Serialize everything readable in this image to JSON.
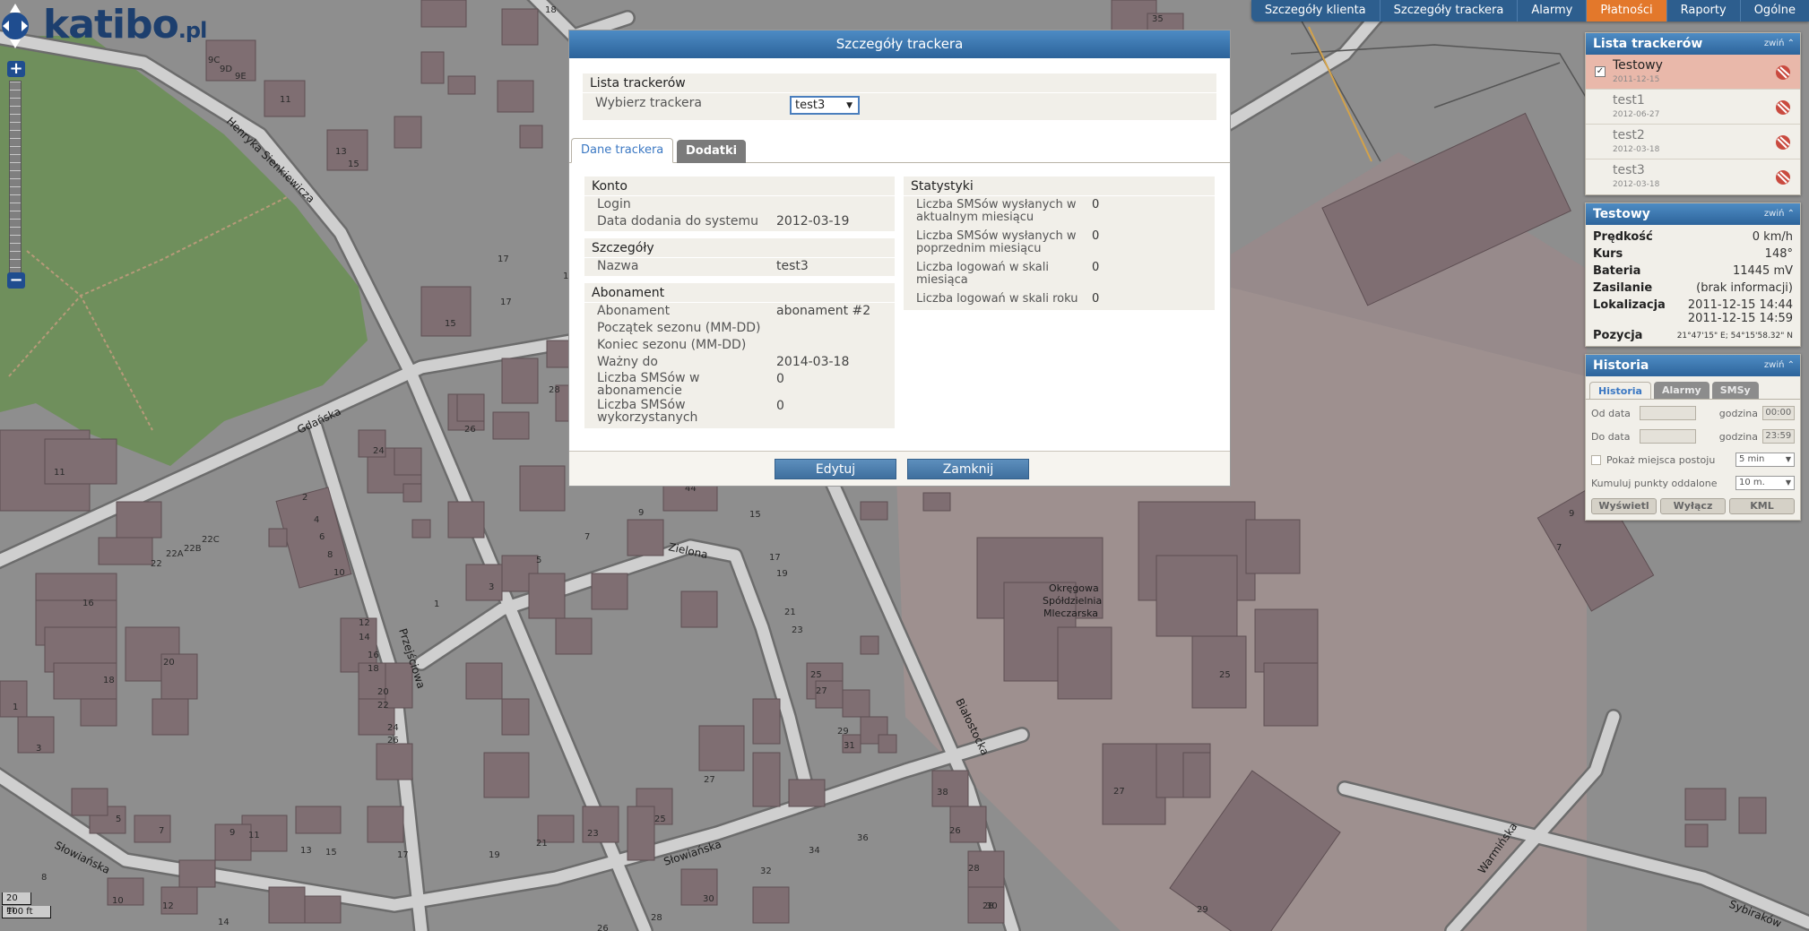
{
  "logo": {
    "text": "katibo",
    "tld": ".pl"
  },
  "topmenu": {
    "items": [
      "Szczegóły klienta",
      "Szczegóły trackera",
      "Alarmy",
      "Płatności",
      "Raporty",
      "Ogólne"
    ],
    "active_index": 3
  },
  "map": {
    "streets": [
      "Henryka Sienkiewicza",
      "Gdańska",
      "Przejściowa",
      "Zielona",
      "Białostocka",
      "Słowiańska",
      "Słowiańska",
      "Warmińska",
      "Sybiraków"
    ],
    "poi_label_lines": [
      "Okręgowa",
      "Spółdzielnia",
      "Mleczarska"
    ],
    "house_numbers": [
      "18",
      "35",
      "9C",
      "9D",
      "9E",
      "11",
      "13",
      "15",
      "17",
      "15",
      "28",
      "26",
      "24",
      "11",
      "26",
      "2",
      "4",
      "6",
      "8",
      "10",
      "22",
      "22A",
      "22B",
      "22C",
      "16",
      "20",
      "18",
      "1",
      "3",
      "1",
      "3",
      "5",
      "7",
      "9",
      "11",
      "13",
      "15",
      "12",
      "14",
      "16",
      "18",
      "20",
      "22",
      "24",
      "26",
      "17",
      "21",
      "23",
      "25",
      "27",
      "29",
      "31",
      "34",
      "36",
      "38",
      "26",
      "28",
      "30",
      "27",
      "25",
      "23",
      "21",
      "19",
      "17",
      "19",
      "21",
      "23",
      "25",
      "27",
      "29",
      "30",
      "32",
      "44",
      "15",
      "9",
      "7",
      "5",
      "3",
      "25",
      "27",
      "7",
      "9",
      "2",
      "12",
      "14",
      "16"
    ],
    "scale": {
      "metric": "20 m",
      "imperial": "100 ft"
    }
  },
  "tracker_list_panel": {
    "title": "Lista trackerów",
    "collapse_label": "zwiń",
    "items": [
      {
        "name": "Testowy",
        "date": "2011-12-15",
        "checked": true,
        "selected": true
      },
      {
        "name": "test1",
        "date": "2012-06-27",
        "checked": false,
        "selected": false
      },
      {
        "name": "test2",
        "date": "2012-03-18",
        "checked": false,
        "selected": false
      },
      {
        "name": "test3",
        "date": "2012-03-18",
        "checked": false,
        "selected": false
      }
    ]
  },
  "info_panel": {
    "title": "Testowy",
    "collapse_label": "zwiń",
    "rows": [
      {
        "label": "Prędkość",
        "value": "0 km/h"
      },
      {
        "label": "Kurs",
        "value": "148°"
      },
      {
        "label": "Bateria",
        "value": "11445 mV"
      },
      {
        "label": "Zasilanie",
        "value": "(brak informacji)"
      },
      {
        "label": "Lokalizacja",
        "value": "2011-12-15 14:44 2011-12-15 14:59"
      },
      {
        "label": "Pozycja",
        "value": "21°47'15\" E; 54°15'58.32\" N"
      }
    ]
  },
  "history_panel": {
    "title": "Historia",
    "collapse_label": "zwiń",
    "tabs": [
      "Historia",
      "Alarmy",
      "SMSy"
    ],
    "from_label": "Od data",
    "to_label": "Do data",
    "time_label": "godzina",
    "from_time": "00:00",
    "to_time": "23:59",
    "stops_label": "Pokaż miejsca postoju",
    "stops_value": "5 min",
    "cumulate_label": "Kumuluj punkty oddalone",
    "cumulate_value": "10 m.",
    "buttons": [
      "Wyświetl",
      "Wyłącz",
      "KML"
    ]
  },
  "modal": {
    "title": "Szczegóły trackera",
    "select_section": {
      "title": "Lista trackerów",
      "label": "Wybierz trackera",
      "selected": "test3"
    },
    "tabs": [
      "Dane trackera",
      "Dodatki"
    ],
    "konto": {
      "title": "Konto",
      "rows": [
        {
          "label": "Login",
          "value": ""
        },
        {
          "label": "Data dodania do systemu",
          "value": "2012-03-19"
        }
      ]
    },
    "szczegoly": {
      "title": "Szczegóły",
      "rows": [
        {
          "label": "Nazwa",
          "value": "test3"
        }
      ]
    },
    "abonament": {
      "title": "Abonament",
      "rows": [
        {
          "label": "Abonament",
          "value": "abonament #2"
        },
        {
          "label": "Początek sezonu (MM-DD)",
          "value": ""
        },
        {
          "label": "Koniec sezonu (MM-DD)",
          "value": ""
        },
        {
          "label": "Ważny do",
          "value": "2014-03-18"
        },
        {
          "label": "Liczba SMSów w abonamencie",
          "value": "0"
        },
        {
          "label": "Liczba SMSów wykorzystanych",
          "value": "0"
        }
      ]
    },
    "statystyki": {
      "title": "Statystyki",
      "rows": [
        {
          "label": "Liczba SMSów wysłanych w aktualnym miesiącu",
          "value": "0"
        },
        {
          "label": "Liczba SMSów wysłanych w poprzednim miesiącu",
          "value": "0"
        },
        {
          "label": "Liczba logowań w skali miesiąca",
          "value": "0"
        },
        {
          "label": "Liczba logowań w skali roku",
          "value": "0"
        }
      ]
    },
    "buttons": {
      "edit": "Edytuj",
      "close": "Zamknij"
    }
  }
}
